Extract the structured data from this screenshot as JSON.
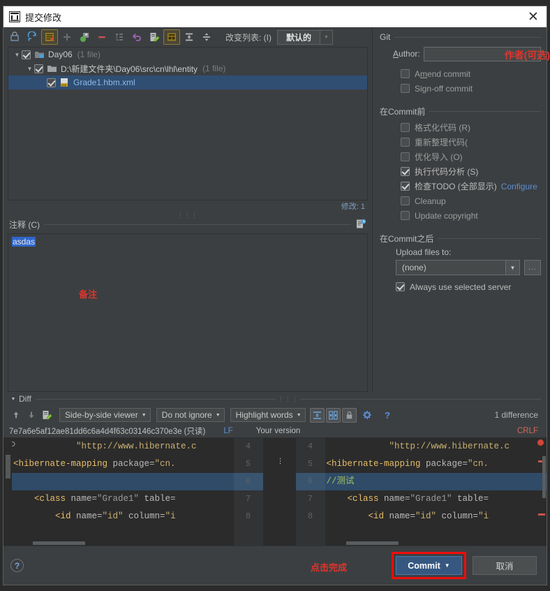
{
  "window": {
    "title": "提交修改",
    "close_icon": "close-icon"
  },
  "toolbar": {
    "changelist_label": "改变列表: (I)",
    "changelist_value": "默认的",
    "icons": [
      "refresh-rollback-icon",
      "refresh-icon",
      "show-diff-icon",
      "add-icon",
      "move-to-changelist-icon",
      "delete-icon",
      "group-by-icon",
      "revert-icon",
      "edit-source-icon",
      "preview-diff-icon",
      "expand-all-icon",
      "collapse-all-icon"
    ]
  },
  "file_tree": {
    "modified_label": "修改: 1",
    "rows": [
      {
        "indent": 0,
        "triangle": "▼",
        "checked": true,
        "icon": "module-icon",
        "name": "Day06",
        "meta": "(1 file)",
        "selected": false
      },
      {
        "indent": 1,
        "triangle": "▼",
        "checked": true,
        "icon": "folder-icon",
        "name": "D:\\新建文件夹\\Day06\\src\\cn\\lhl\\entity",
        "meta": "(1 file)",
        "selected": false
      },
      {
        "indent": 2,
        "triangle": "",
        "checked": true,
        "icon": "xml-file-icon",
        "name": "Grade1.hbm.xml",
        "meta": "",
        "selected": true
      }
    ]
  },
  "comment": {
    "section_label": "注释 (C)",
    "history_icon": "commit-message-history-icon",
    "text": "asdas",
    "annotation": "备注"
  },
  "git_panel": {
    "section_label": "Git",
    "author_label": "Author:",
    "author_value": "",
    "author_annotation": "作者(可选)",
    "amend_commit": "Amend commit",
    "sign_off_commit": "Sign-off commit",
    "before_commit_label": "在Commit前",
    "before_commit_options": [
      {
        "label": "格式化代码 (R)",
        "checked": false
      },
      {
        "label": "重新整理代码(",
        "checked": false
      },
      {
        "label": "优化导入 (O)",
        "checked": false
      },
      {
        "label": "执行代码分析 (S)",
        "checked": true
      },
      {
        "label": "检查TODO (全部显示)",
        "checked": true,
        "link": "Configure"
      },
      {
        "label": "Cleanup",
        "checked": false
      },
      {
        "label": "Update copyright",
        "checked": false
      }
    ],
    "after_commit_label": "在Commit之后",
    "upload_label": "Upload files to:",
    "upload_value": "(none)",
    "browse_label": "...",
    "always_use_server": "Always use selected server",
    "always_use_server_checked": true
  },
  "diff": {
    "section_label": "Diff",
    "viewer_mode": "Side-by-side viewer",
    "ignore_mode": "Do not ignore",
    "highlight_mode": "Highlight words",
    "difference_count": "1 difference",
    "left_header": "7e7a6e5af12ae81dd6c6a4d4f63c03146c370e3e (只读)",
    "left_sep": "LF",
    "right_header": "Your version",
    "right_sep": "CRLF",
    "left_lines": [
      {
        "num": "4",
        "segments": [
          {
            "t": "            \"http://www.hibernate.c",
            "c": "tk-str"
          }
        ],
        "hl": false
      },
      {
        "num": "5",
        "segments": [
          {
            "t": "<hibernate-mapping ",
            "c": "tk-tag"
          },
          {
            "t": "package=",
            "c": "tk-att"
          },
          {
            "t": "\"cn.",
            "c": "tk-str"
          }
        ],
        "hl": false
      },
      {
        "num": "6",
        "segments": [
          {
            "t": "",
            "c": "tk-gray"
          }
        ],
        "hl": true
      },
      {
        "num": "7",
        "segments": [
          {
            "t": "    <class ",
            "c": "tk-tag"
          },
          {
            "t": "name=",
            "c": "tk-att"
          },
          {
            "t": "\"Grade1\"",
            "c": "tk-gray"
          },
          {
            "t": " table=",
            "c": "tk-att"
          }
        ],
        "hl": false
      },
      {
        "num": "8",
        "segments": [
          {
            "t": "        <id ",
            "c": "tk-tag"
          },
          {
            "t": "name=",
            "c": "tk-att"
          },
          {
            "t": "\"id\"",
            "c": "tk-str"
          },
          {
            "t": " column=",
            "c": "tk-att"
          },
          {
            "t": "\"i",
            "c": "tk-str"
          }
        ],
        "hl": false
      }
    ],
    "right_lines": [
      {
        "num": "4",
        "segments": [
          {
            "t": "            \"http://www.hibernate.c",
            "c": "tk-str"
          }
        ],
        "hl": false
      },
      {
        "num": "5",
        "segments": [
          {
            "t": "<hibernate-mapping ",
            "c": "tk-tag"
          },
          {
            "t": "package=",
            "c": "tk-att"
          },
          {
            "t": "\"cn.",
            "c": "tk-str"
          }
        ],
        "hl": false
      },
      {
        "num": "6",
        "segments": [
          {
            "t": "//测试",
            "c": "tk-s"
          }
        ],
        "hl": true
      },
      {
        "num": "7",
        "segments": [
          {
            "t": "    <class ",
            "c": "tk-tag"
          },
          {
            "t": "name=",
            "c": "tk-att"
          },
          {
            "t": "\"Grade1\"",
            "c": "tk-gray"
          },
          {
            "t": " table=",
            "c": "tk-att"
          }
        ],
        "hl": false
      },
      {
        "num": "8",
        "segments": [
          {
            "t": "        <id ",
            "c": "tk-tag"
          },
          {
            "t": "name=",
            "c": "tk-att"
          },
          {
            "t": "\"id\"",
            "c": "tk-str"
          },
          {
            "t": " column=",
            "c": "tk-att"
          },
          {
            "t": "\"i",
            "c": "tk-str"
          }
        ],
        "hl": false
      }
    ]
  },
  "footer": {
    "help_label": "?",
    "annotation": "点击完成",
    "commit_label": "Commit",
    "cancel_label": "取消"
  },
  "colors": {
    "accent_blue": "#365880",
    "annotation_red": "#e2342c",
    "highlight_blue": "#2f4b68",
    "link_blue": "#5b8fd6",
    "green_text": "#a5c261"
  }
}
